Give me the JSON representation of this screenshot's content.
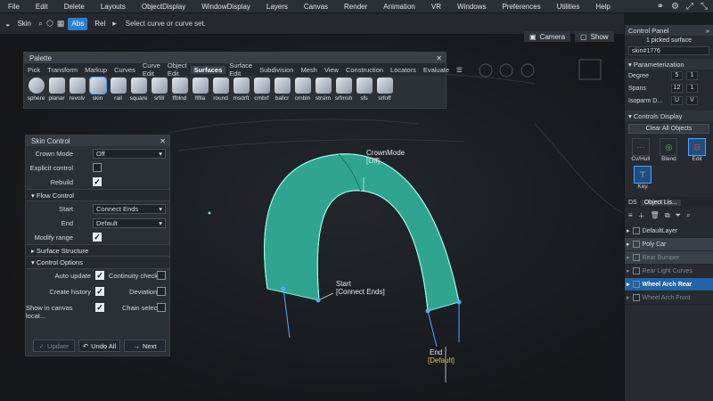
{
  "menubar": {
    "items": [
      "File",
      "Edit",
      "Delete",
      "Layouts",
      "ObjectDisplay",
      "WindowDisplay",
      "Layers",
      "Canvas",
      "Render",
      "Animation",
      "VR",
      "Windows",
      "Preferences",
      "Utilities",
      "Help"
    ]
  },
  "toolbar": {
    "skin_label": "Skin",
    "abs_label": "Abs",
    "rel_label": "Rel",
    "hint": "Select curve or curve set."
  },
  "viewport": {
    "camera_label": "Camera",
    "show_label": "Show"
  },
  "palette": {
    "title": "Palette",
    "tabs": [
      "Pick",
      "Transform",
      "Markup",
      "Curves",
      "Curve Edit",
      "Object Edit",
      "Surfaces",
      "Surface Edit",
      "Subdivision",
      "Mesh",
      "View",
      "Construction",
      "Locators",
      "Evaluate"
    ],
    "active_tab": "Surfaces",
    "tools": [
      "sphere",
      "planar",
      "revolv",
      "skin",
      "rail",
      "square",
      "srfill",
      "ffblnd",
      "flflla",
      "round",
      "msdrft",
      "cmbrf",
      "ballcr",
      "crnbln",
      "strsim",
      "srfmsh",
      "sfs",
      "srfoff"
    ]
  },
  "skin_control": {
    "title": "Skin Control",
    "crown_mode_label": "Crown Mode",
    "crown_mode_value": "Off",
    "explicit_control_label": "Explicit control",
    "rebuild_label": "Rebuild",
    "flow_control_label": "Flow Control",
    "start_label": "Start",
    "start_value": "Connect Ends",
    "end_label": "End",
    "end_value": "Default",
    "modify_range_label": "Modify range",
    "surface_structure_label": "Surface Structure",
    "control_options_label": "Control Options",
    "auto_update_label": "Auto update",
    "create_history_label": "Create history",
    "show_in_canvas_label": "Show in canvas locat...",
    "continuity_check_label": "Continuity check",
    "deviation_label": "Deviation",
    "chain_select_label": "Chain select",
    "update_btn": "Update",
    "undo_all_btn": "Undo All",
    "next_btn": "Next"
  },
  "scene_labels": {
    "crown_mode_title": "CrownMode",
    "crown_mode_val": "[Off]",
    "start_title": "Start",
    "start_val": "[Connect Ends]",
    "end_title": "End",
    "end_val": "[Default]"
  },
  "control_panel": {
    "title": "Control Panel",
    "picked": "1 picked surface",
    "object_name": "skin#1776",
    "param_label": "Parameterization",
    "degree_label": "Degree",
    "degree_u": "5",
    "degree_v": "1",
    "spans_label": "Spans",
    "spans_u": "12",
    "spans_v": "1",
    "isoparm_label": "Isoparm D...",
    "isoparm_u": "U",
    "isoparm_v": "V",
    "controls_display_label": "Controls Display",
    "clear_all_label": "Clear All Objects",
    "cvhull_label": "Cv/Hull",
    "blend_label": "Blend",
    "edit_label": "Edit",
    "key_label": "Key",
    "ds_tab": "DS",
    "object_list_tab": "Object Lis...",
    "objects": [
      "DefaultLayer",
      "Poly Car",
      "Rear Bumper",
      "Rear Light Curves",
      "Wheel Arch Rear",
      "Wheel Arch Front"
    ]
  },
  "colors": {
    "accent": "#2d7fd0",
    "surface": "#2fb7a3",
    "selection": "#2363a8",
    "highlight": "#e6c34c"
  }
}
